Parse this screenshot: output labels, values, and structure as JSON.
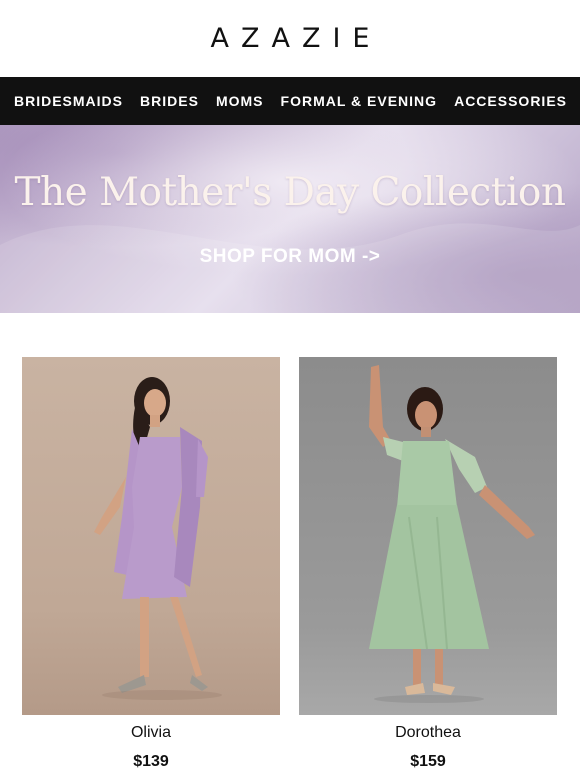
{
  "brand": {
    "logo_text": "AZAZIE"
  },
  "nav": {
    "items": [
      {
        "label": "BRIDESMAIDS"
      },
      {
        "label": "BRIDES"
      },
      {
        "label": "MOMS"
      },
      {
        "label": "FORMAL & EVENING"
      },
      {
        "label": "ACCESSORIES"
      }
    ]
  },
  "hero": {
    "title": "The Mother's Day Collection",
    "cta_label": "SHOP FOR MOM ->"
  },
  "products": [
    {
      "name": "Olivia",
      "price": "$139",
      "dress_color": "#b99bcb",
      "background": "#c4ad9c"
    },
    {
      "name": "Dorothea",
      "price": "$159",
      "dress_color": "#a9c9a6",
      "background": "#8f8f8f"
    }
  ]
}
